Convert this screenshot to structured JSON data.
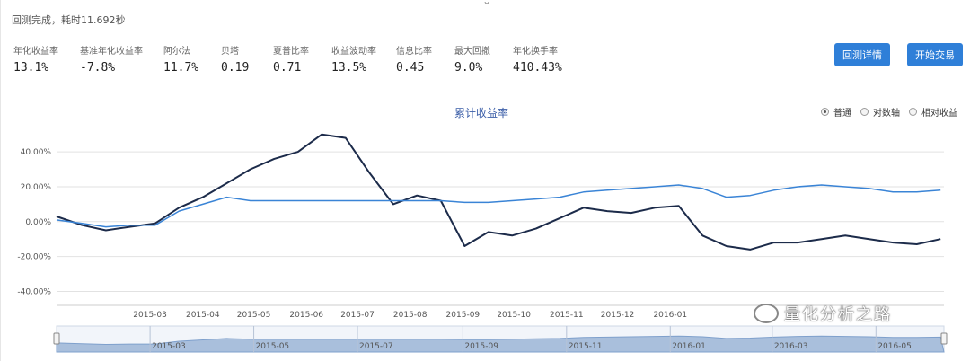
{
  "status_text": "回测完成，耗时11.692秒",
  "stats": [
    {
      "label": "年化收益率",
      "value": "13.1%"
    },
    {
      "label": "基准年化收益率",
      "value": "-7.8%"
    },
    {
      "label": "阿尔法",
      "value": "11.7%"
    },
    {
      "label": "贝塔",
      "value": "0.19"
    },
    {
      "label": "夏普比率",
      "value": "0.71"
    },
    {
      "label": "收益波动率",
      "value": "13.5%"
    },
    {
      "label": "信息比率",
      "value": "0.45"
    },
    {
      "label": "最大回撤",
      "value": "9.0%"
    },
    {
      "label": "年化换手率",
      "value": "410.43%"
    }
  ],
  "buttons": {
    "detail": "回测详情",
    "trade": "开始交易"
  },
  "watermark": "量化分析之路",
  "chart_data": {
    "type": "line",
    "title": "累计收益率",
    "modes": [
      {
        "label": "普通",
        "selected": true
      },
      {
        "label": "对数轴",
        "selected": false
      },
      {
        "label": "相对收益",
        "selected": false
      }
    ],
    "yticks": [
      "40.00%",
      "20.00%",
      "0.00%",
      "-20.00%",
      "-40.00%"
    ],
    "ylim": [
      -48,
      55
    ],
    "xticks": [
      "2015-03",
      "2015-04",
      "2015-05",
      "2015-06",
      "2015-07",
      "2015-08",
      "2015-09",
      "2015-10",
      "2015-11",
      "2015-12",
      "2016-01"
    ],
    "navigator_ticks": [
      "2015-03",
      "2015-05",
      "2015-07",
      "2015-09",
      "2015-11",
      "2016-01",
      "2016-03",
      "2016-05"
    ],
    "x": [
      "2015-01-05",
      "2015-01-20",
      "2015-02-03",
      "2015-02-17",
      "2015-03-04",
      "2015-03-18",
      "2015-04-01",
      "2015-04-15",
      "2015-04-29",
      "2015-05-13",
      "2015-05-27",
      "2015-06-10",
      "2015-06-24",
      "2015-07-08",
      "2015-07-22",
      "2015-08-05",
      "2015-08-19",
      "2015-09-02",
      "2015-09-16",
      "2015-09-30",
      "2015-10-14",
      "2015-10-28",
      "2015-11-11",
      "2015-11-25",
      "2015-12-09",
      "2015-12-23",
      "2016-01-06",
      "2016-01-20",
      "2016-02-03",
      "2016-02-17",
      "2016-03-02",
      "2016-03-16",
      "2016-03-30",
      "2016-04-13",
      "2016-04-27",
      "2016-05-11",
      "2016-05-25",
      "2016-06-08"
    ],
    "series": [
      {
        "color": "#1c2b4a",
        "values": [
          3,
          -2,
          -5,
          -3,
          -1,
          8,
          14,
          22,
          30,
          36,
          40,
          50,
          48,
          28,
          10,
          15,
          12,
          -14,
          -6,
          -8,
          -4,
          2,
          8,
          6,
          5,
          8,
          9,
          -8,
          -14,
          -16,
          -12,
          -12,
          -10,
          -8,
          -10,
          -12,
          -13,
          -10
        ]
      },
      {
        "color": "#3a84d6",
        "values": [
          1,
          -1,
          -3,
          -2,
          -2,
          6,
          10,
          14,
          12,
          12,
          12,
          12,
          12,
          12,
          12,
          12,
          12,
          11,
          11,
          12,
          13,
          14,
          17,
          18,
          19,
          20,
          21,
          19,
          14,
          15,
          18,
          20,
          21,
          20,
          19,
          17,
          17,
          18
        ]
      }
    ]
  }
}
